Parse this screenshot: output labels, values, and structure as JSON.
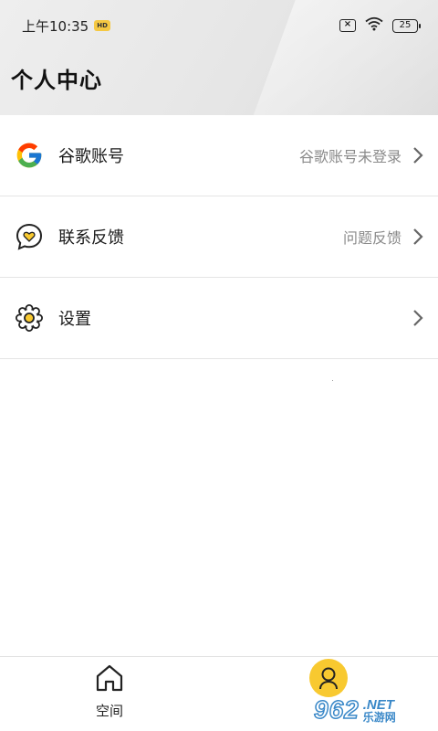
{
  "status_bar": {
    "time": "上午10:35",
    "badge": "HD",
    "battery": "25"
  },
  "header": {
    "title": "个人中心"
  },
  "menu": [
    {
      "icon": "google-icon",
      "label": "谷歌账号",
      "value": "谷歌账号未登录"
    },
    {
      "icon": "feedback-chat-heart-icon",
      "label": "联系反馈",
      "value": "问题反馈"
    },
    {
      "icon": "settings-gear-icon",
      "label": "设置",
      "value": ""
    }
  ],
  "bottom_nav": {
    "items": [
      {
        "icon": "home-icon",
        "label": "空间"
      },
      {
        "icon": "profile-icon",
        "label": ""
      }
    ],
    "accent": "#f8c930"
  },
  "watermark": {
    "number": "962",
    "net": ".NET",
    "cn": "乐游网"
  },
  "colors": {
    "header_bg": "#e6e6e6",
    "text_secondary": "#8a8a8a",
    "accent_yellow": "#f8c930"
  }
}
